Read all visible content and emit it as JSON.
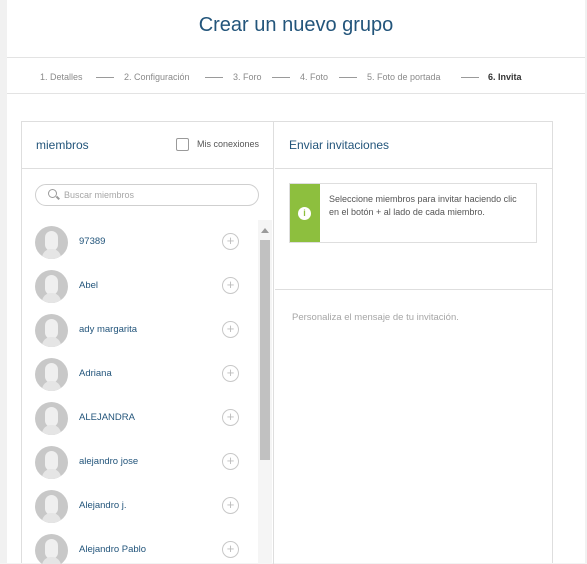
{
  "header": {
    "title": "Crear un nuevo grupo"
  },
  "steps": [
    {
      "label": "1. Detalles",
      "active": false
    },
    {
      "label": "2. Configuración",
      "active": false
    },
    {
      "label": "3. Foro",
      "active": false
    },
    {
      "label": "4. Foto",
      "active": false
    },
    {
      "label": "5. Foto de portada",
      "active": false
    },
    {
      "label": "6. Invita",
      "active": true
    }
  ],
  "members_panel": {
    "title": "miembros",
    "connections_label": "Mis conexiones",
    "connections_checked": false,
    "search_placeholder": "Buscar miembros",
    "members": [
      {
        "name": "97389"
      },
      {
        "name": "Abel"
      },
      {
        "name": "ady margarita"
      },
      {
        "name": "Adriana"
      },
      {
        "name": "ALEJANDRA"
      },
      {
        "name": "alejandro jose"
      },
      {
        "name": "Alejandro j."
      },
      {
        "name": "Alejandro Pablo"
      }
    ],
    "add_symbol": "+"
  },
  "invite_panel": {
    "title": "Enviar invitaciones",
    "notice_icon": "i",
    "notice_text": "Seleccione miembros para invitar haciendo clic en el botón + al lado de cada miembro.",
    "message_placeholder": "Personaliza el mensaje de tu invitación."
  },
  "colors": {
    "title_blue": "#23557b",
    "notice_green": "#8dbf3e"
  }
}
